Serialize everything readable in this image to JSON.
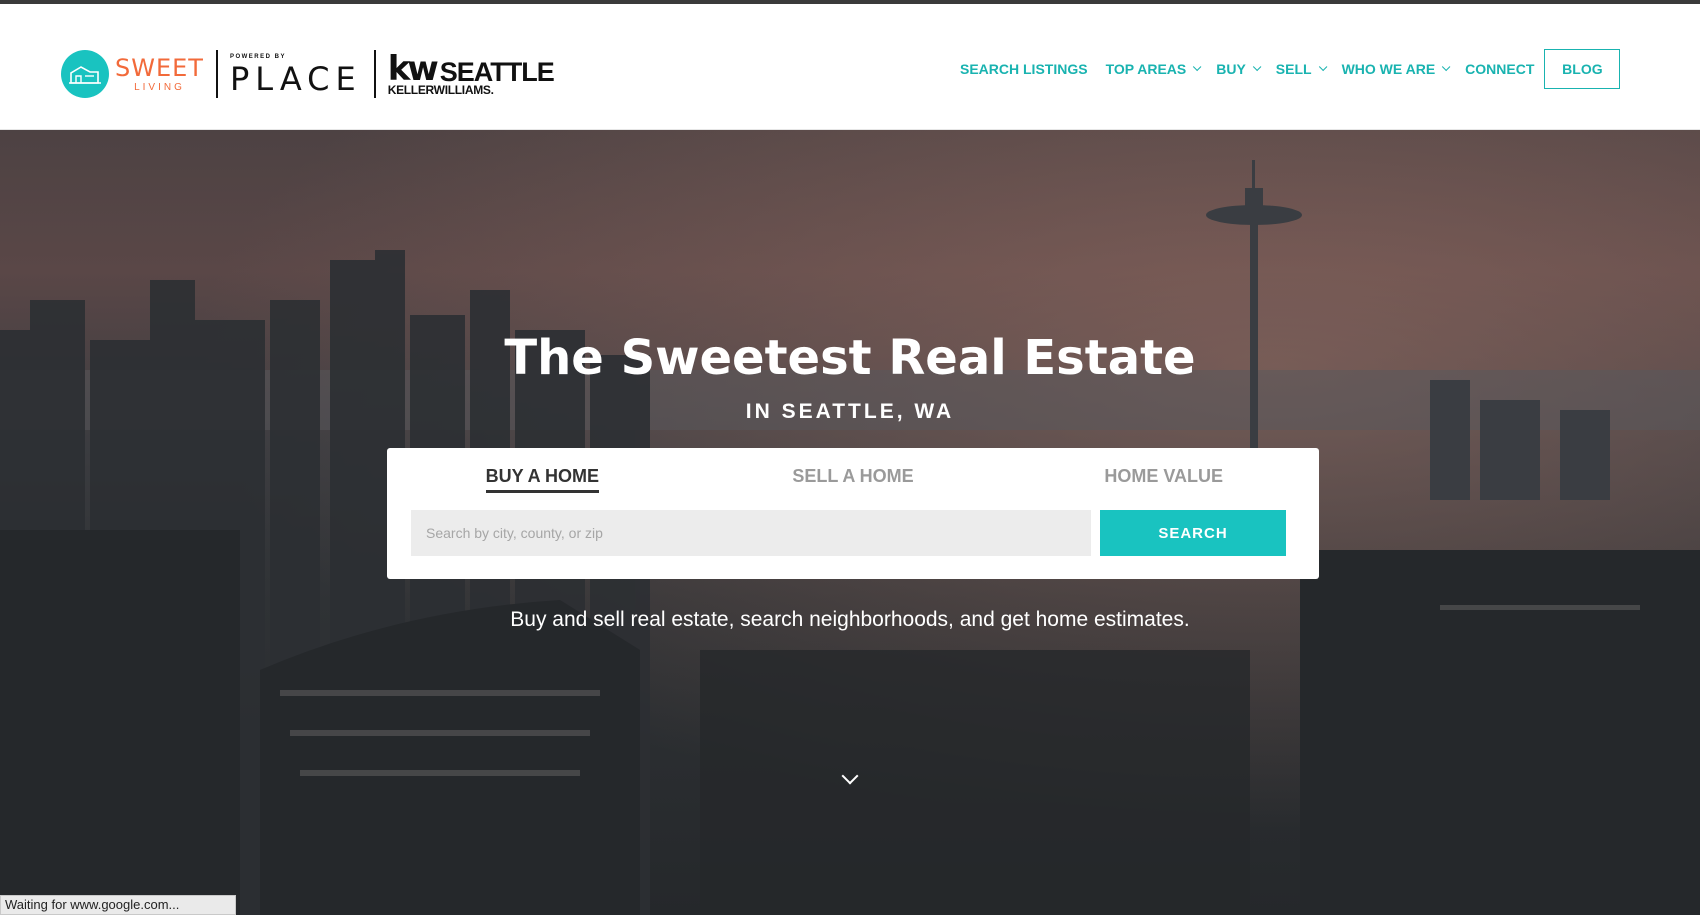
{
  "header": {
    "logos": {
      "sweet": {
        "word": "SWEET",
        "sub": "LIVING"
      },
      "place": {
        "powered": "POWERED BY",
        "word": "PLACE"
      },
      "kw": {
        "mark": "kw",
        "city": "SEATTLE",
        "brand": "KELLERWILLIAMS."
      }
    },
    "nav": [
      {
        "label": "SEARCH LISTINGS",
        "dropdown": false
      },
      {
        "label": "TOP AREAS",
        "dropdown": true
      },
      {
        "label": "BUY",
        "dropdown": true
      },
      {
        "label": "SELL",
        "dropdown": true
      },
      {
        "label": "WHO WE ARE",
        "dropdown": true
      },
      {
        "label": "CONNECT",
        "dropdown": false
      }
    ],
    "blog_label": "BLOG"
  },
  "hero": {
    "title": "The Sweetest Real Estate",
    "subtitle": "IN SEATTLE, WA",
    "tabs": [
      {
        "label": "BUY A HOME",
        "active": true
      },
      {
        "label": "SELL A HOME",
        "active": false
      },
      {
        "label": "HOME VALUE",
        "active": false
      }
    ],
    "search_placeholder": "Search by city, county, or zip",
    "search_value": "",
    "search_button": "SEARCH",
    "tagline": "Buy and sell real estate, search neighborhoods, and get home estimates."
  },
  "status_bar": {
    "text": "Waiting for www.google.com..."
  },
  "colors": {
    "accent": "#19c3c0",
    "logo_orange": "#f26a3a",
    "dark": "#111111"
  }
}
